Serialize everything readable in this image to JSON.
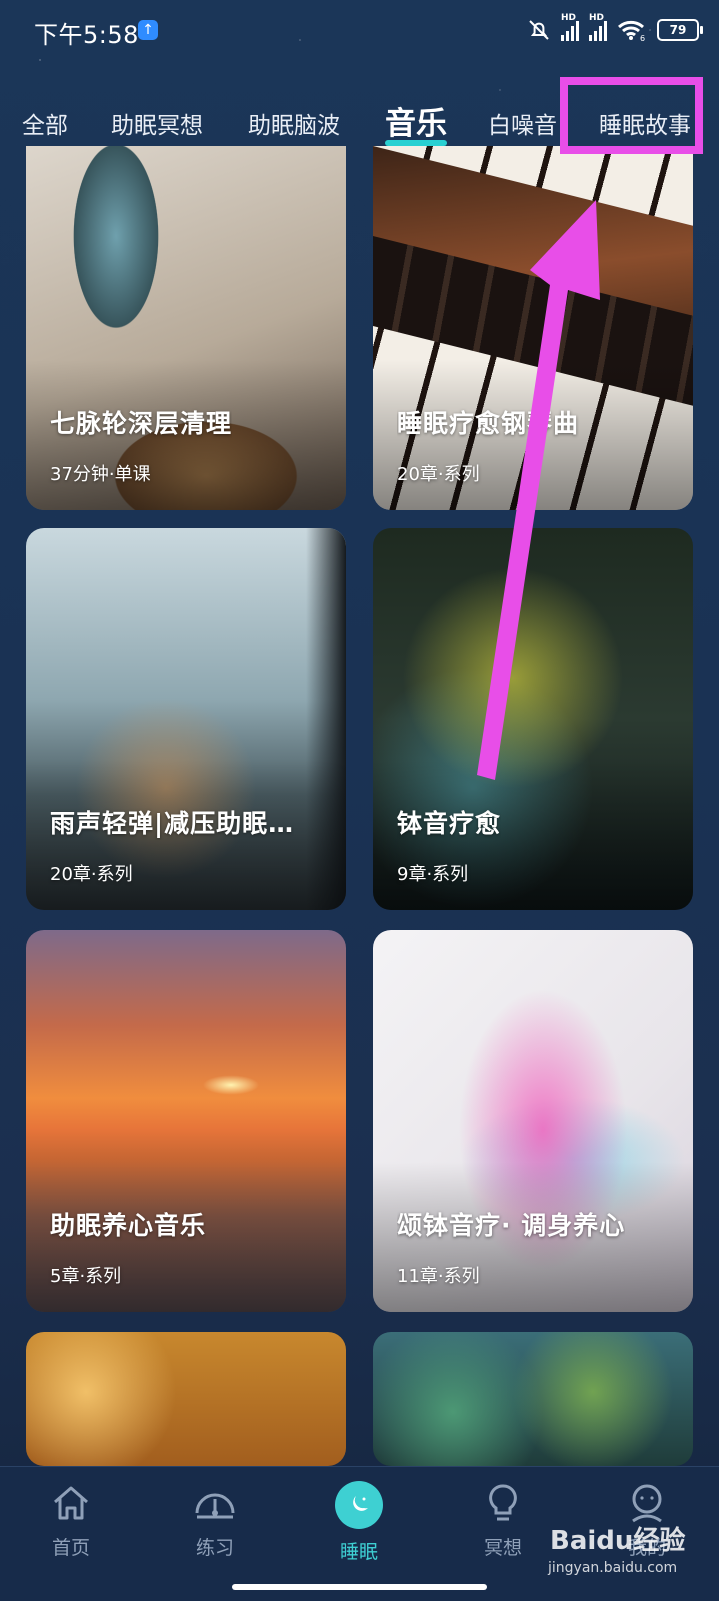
{
  "status_bar": {
    "time": "下午5:58",
    "hd1": "HD",
    "hd2": "HD",
    "wifi_badge": "6",
    "battery": "79"
  },
  "tabs": [
    {
      "label": "全部"
    },
    {
      "label": "助眠冥想"
    },
    {
      "label": "助眠脑波"
    },
    {
      "label": "音乐"
    },
    {
      "label": "白噪音"
    },
    {
      "label": "睡眠故事"
    }
  ],
  "active_tab": "音乐",
  "cards": [
    {
      "title": "七脉轮深层清理",
      "meta": "37分钟·单课"
    },
    {
      "title": "睡眠疗愈钢琴曲",
      "meta": "20章·系列"
    },
    {
      "title": "雨声轻弹|减压助眠…",
      "meta": "20章·系列"
    },
    {
      "title": "钵音疗愈",
      "meta": "9章·系列"
    },
    {
      "title": "助眠养心音乐",
      "meta": "5章·系列"
    },
    {
      "title": "颂钵音疗· 调身养心",
      "meta": "11章·系列"
    }
  ],
  "bottom_nav": [
    {
      "label": "首页",
      "icon": "home-icon"
    },
    {
      "label": "练习",
      "icon": "gauge-icon"
    },
    {
      "label": "睡眠",
      "icon": "moon-icon"
    },
    {
      "label": "冥想",
      "icon": "bulb-icon"
    },
    {
      "label": "我的",
      "icon": "user-icon"
    }
  ],
  "watermark": {
    "brand": "Baidu经验",
    "url": "jingyan.baidu.com"
  },
  "colors": {
    "accent": "#3ecfd3",
    "annotation": "#e84ee8",
    "background": "#1a3254"
  }
}
